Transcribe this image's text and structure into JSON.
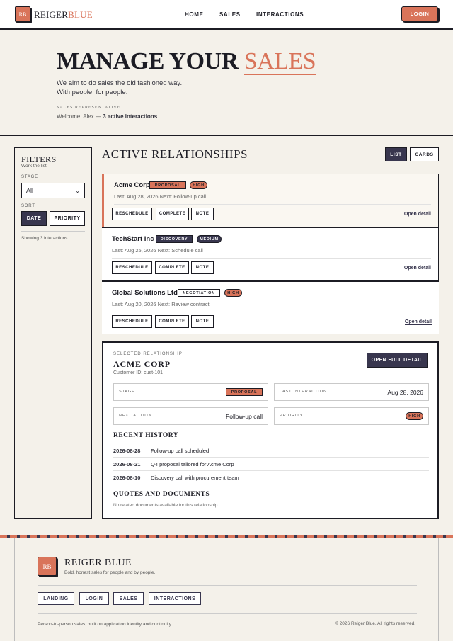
{
  "header": {
    "logo_text": "RB",
    "brand_part1": "REIGER",
    "brand_part2": "BLUE",
    "nav": [
      "HOME",
      "SALES",
      "INTERACTIONS"
    ],
    "login_label": "LOGIN"
  },
  "hero": {
    "title_main": "MANAGE YOUR",
    "title_accent": "SALES",
    "line1": "We aim to do sales the old fashioned way.",
    "line2": "With people, for people.",
    "rep_label": "SALES REPRESENTATIVE",
    "welcome_prefix": "Welcome, Alex —",
    "welcome_link": "3 active interactions"
  },
  "filters": {
    "title": "FILTERS",
    "subtitle": "Work the list",
    "stage_label": "STAGE",
    "stage_value": "All",
    "sort_label": "SORT",
    "sort_date": "DATE",
    "sort_priority": "PRIORITY",
    "count_text": "Showing 3 interactions"
  },
  "relationships": {
    "title": "ACTIVE RELATIONSHIPS",
    "view_list": "LIST",
    "view_cards": "CARDS",
    "actions": [
      "RESCHEDULE",
      "COMPLETE",
      "NOTE"
    ],
    "open_label": "Open detail",
    "cards": [
      {
        "name": "Acme Corp",
        "stage": "PROPOSAL",
        "priority": "HIGH",
        "meta": "Last: Aug 28, 2026    Next: Follow-up call"
      },
      {
        "name": "TechStart Inc",
        "stage": "DISCOVERY",
        "priority": "MEDIUM",
        "meta": "Last: Aug 25, 2026    Next: Schedule call"
      },
      {
        "name": "Global Solutions Ltd",
        "stage": "NEGOTIATION",
        "priority": "HIGH",
        "meta": "Last: Aug 20, 2026    Next: Review contract"
      }
    ]
  },
  "detail": {
    "label": "SELECTED RELATIONSHIP",
    "name": "ACME CORP",
    "customer_id": "Customer ID: cust-101",
    "open_full": "OPEN FULL DETAIL",
    "stage_key": "STAGE",
    "stage_value": "PROPOSAL",
    "last_key": "LAST INTERACTION",
    "last_value": "Aug 28, 2026",
    "next_key": "NEXT ACTION",
    "next_value": "Follow-up call",
    "priority_key": "PRIORITY",
    "priority_value": "HIGH",
    "history_title": "RECENT HISTORY",
    "history": [
      {
        "date": "2026-08-28",
        "text": "Follow-up call scheduled"
      },
      {
        "date": "2026-08-21",
        "text": "Q4 proposal tailored for Acme Corp"
      },
      {
        "date": "2026-08-10",
        "text": "Discovery call with procurement team"
      }
    ],
    "docs_title": "QUOTES AND DOCUMENTS",
    "docs_empty": "No related documents available for this relationship."
  },
  "footer": {
    "logo_text": "RB",
    "brand": "REIGER BLUE",
    "tagline": "Bold, honest sales for people and by people.",
    "links": [
      "LANDING",
      "LOGIN",
      "SALES",
      "INTERACTIONS"
    ],
    "note": "Person-to-person sales, built on application identity and continuity.",
    "copyright": "© 2026 Reiger Blue. All rights reserved."
  },
  "colors": {
    "accent": "#d9745a",
    "navy": "#38364e",
    "ink": "#1c1c24",
    "paper": "#f4f1ea"
  }
}
